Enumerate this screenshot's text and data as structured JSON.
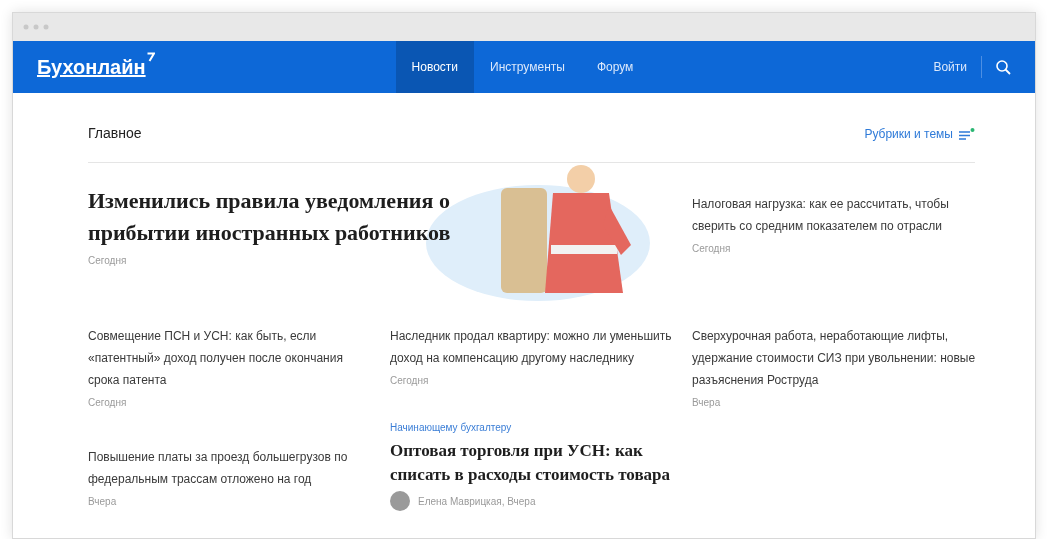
{
  "navbar": {
    "logo": "Бухонлайн",
    "items": [
      {
        "label": "Новости",
        "selected": true
      },
      {
        "label": "Инструменты",
        "selected": false
      },
      {
        "label": "Форум",
        "selected": false
      }
    ],
    "login": "Войти"
  },
  "section": {
    "title": "Главное",
    "rubrics_link": "Рубрики и темы"
  },
  "lead_article": {
    "title": "Изменились правила уведомления о прибытии иностранных работников",
    "date": "Сегодня"
  },
  "side_article": {
    "title": "Налоговая нагрузка: как ее рассчитать, чтобы сверить со средним показателем по отрасли",
    "date": "Сегодня"
  },
  "articles": [
    {
      "kind": "plain",
      "title": "Совмещение ПСН и УСН: как быть, если «патентный» доход получен после окончания срока патента",
      "date": "Сегодня"
    },
    {
      "kind": "plain",
      "title": "Наследник продал квартиру: можно ли уменьшить доход на компенсацию другому наследнику",
      "date": "Сегодня"
    },
    {
      "kind": "plain",
      "title": "Сверхурочная работа, неработающие лифты, удержание стоимости СИЗ при увольнении: новые разъяснения Роструда",
      "date": "Вчера"
    },
    {
      "kind": "plain",
      "title": "Повышение платы за проезд большегрузов по федеральным трассам отложено на год",
      "date": "Вчера"
    },
    {
      "kind": "featured",
      "category": "Начинающему бухгалтеру",
      "title": "Оптовая торговля при УСН: как списать в расходы стоимость товара",
      "byline": "Елена Маврицкая, Вчера"
    }
  ]
}
